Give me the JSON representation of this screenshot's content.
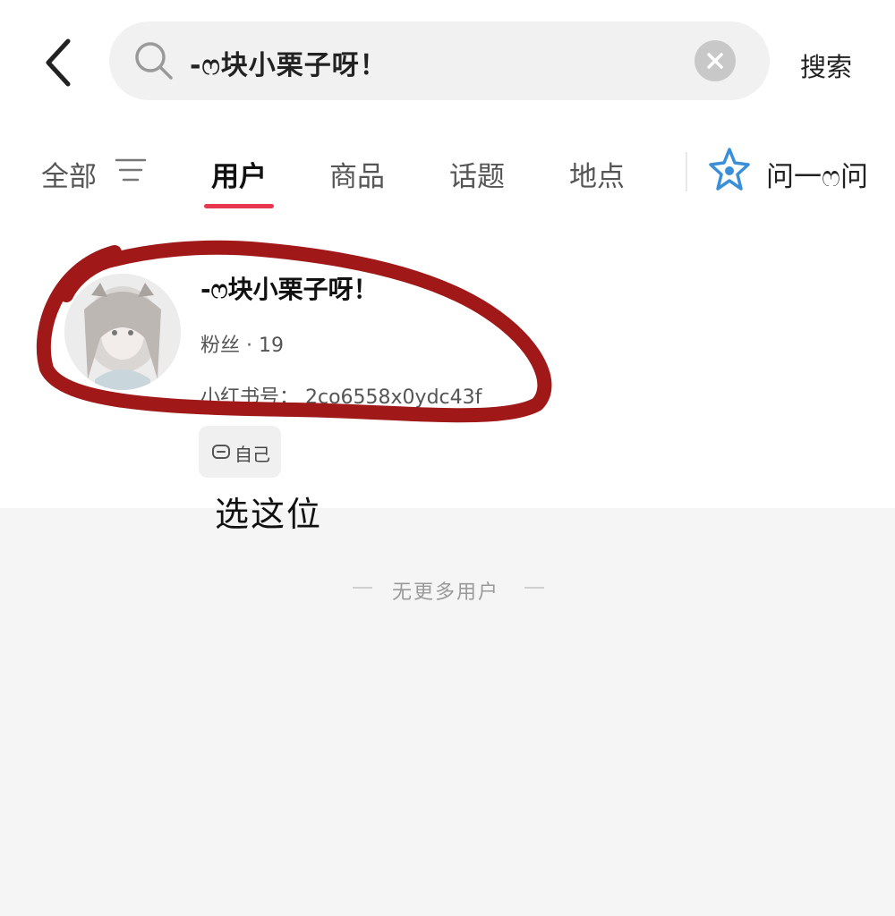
{
  "header": {
    "back_icon": "chevron-left-icon",
    "search": {
      "icon": "search-icon",
      "value": "-ෆ块小栗子呀！",
      "clear_icon": "close-circle-icon"
    },
    "search_button": "搜索"
  },
  "tabs": {
    "items": [
      {
        "label": "全部"
      },
      {
        "label": "用户",
        "active": true
      },
      {
        "label": "商品"
      },
      {
        "label": "话题"
      },
      {
        "label": "地点"
      }
    ],
    "filter_icon": "filter-icon",
    "ask": {
      "icon": "star-logo-icon",
      "label": "问一ෆ问"
    },
    "active_color": "#e8384f"
  },
  "user_result": {
    "name": "-ෆ块小栗子呀！",
    "fans": "粉丝 · 19",
    "xhs_id": "小红书号：  2co6558x0ydc43f",
    "tag": {
      "icon": "self-icon",
      "label": "自己"
    }
  },
  "annotation": {
    "note": "选这位",
    "circle_color": "#a01818"
  },
  "end_of_list": "无更多用户"
}
